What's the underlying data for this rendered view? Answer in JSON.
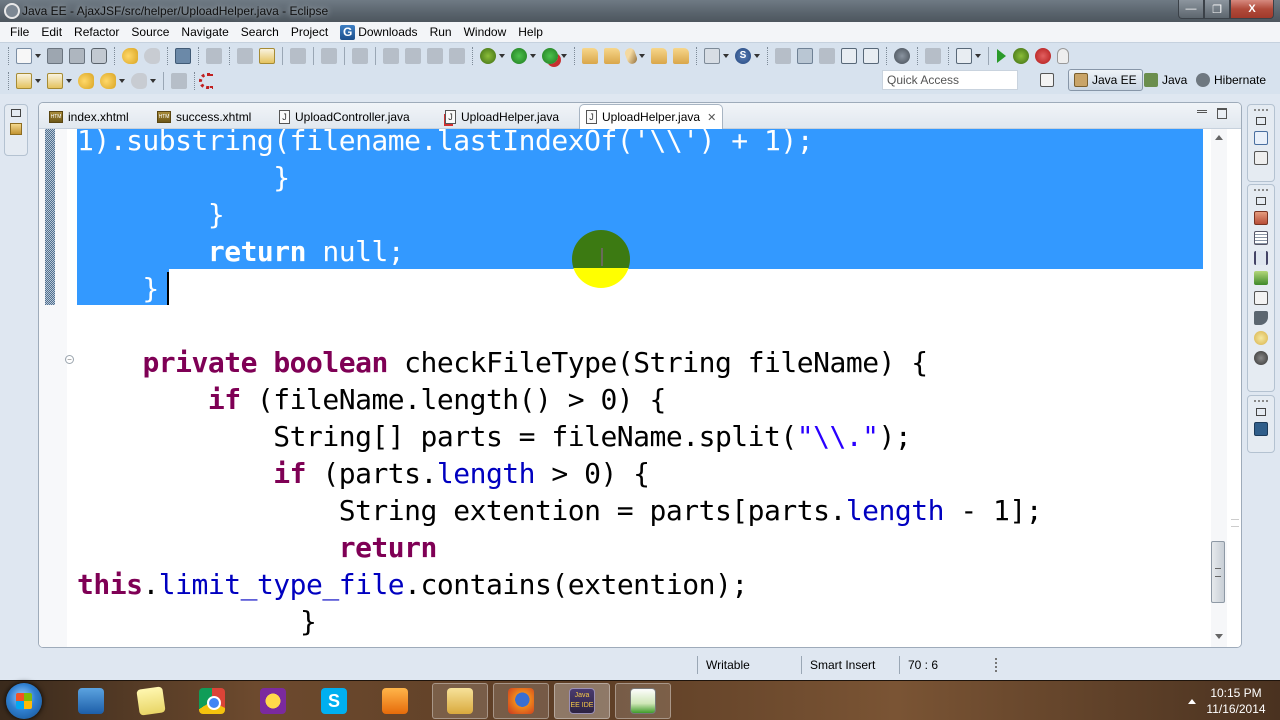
{
  "window": {
    "title": "Java EE - AjaxJSF/src/helper/UploadHelper.java - Eclipse",
    "buttons": {
      "minimize": "—",
      "maximize": "❐",
      "close": "X"
    }
  },
  "menu": {
    "items": [
      "File",
      "Edit",
      "Refactor",
      "Source",
      "Navigate",
      "Search",
      "Project",
      "Downloads",
      "Run",
      "Window",
      "Help"
    ],
    "downloads_icon_letter": "G"
  },
  "toolbar": {
    "quick_access_placeholder": "Quick Access",
    "perspectives": [
      {
        "label": "Java EE",
        "active": true
      },
      {
        "label": "Java",
        "active": false
      },
      {
        "label": "Hibernate",
        "active": false
      }
    ]
  },
  "editor": {
    "tabs": [
      {
        "label": "index.xhtml",
        "type": "xhtml",
        "active": false
      },
      {
        "label": "success.xhtml",
        "type": "xhtml",
        "active": false
      },
      {
        "label": "UploadController.java",
        "type": "java",
        "active": false
      },
      {
        "label": "UploadHelper.java",
        "type": "java-error",
        "active": false
      },
      {
        "label": "UploadHelper.java",
        "type": "java",
        "active": true
      }
    ],
    "tab_close_glyph": "✕",
    "fold_glyph": "−",
    "code": {
      "line1": "1).substring(filename.lastIndexOf('\\\\') + 1);",
      "line2": "            }",
      "line3": "        }",
      "line4_kw": "return",
      "line4_rest": " null;",
      "line5": "    }",
      "line7_kw1": "private",
      "line7_kw2": "boolean",
      "line7_rest": " checkFileType(String fileName) {",
      "line8_kw": "if",
      "line8_rest": " (fileName.length() > 0) {",
      "line9_a": "String[] parts = fileName.split(",
      "line9_str": "\"\\\\.\"",
      "line9_b": ");",
      "line10_kw": "if",
      "line10_a": " (parts.",
      "line10_fld": "length",
      "line10_b": " > 0) {",
      "line11_a": "String extention = parts[parts.",
      "line11_fld": "length",
      "line11_b": " - 1];",
      "line12_kw": "return",
      "line13_kw": "this",
      "line13_a": ".",
      "line13_fld": "limit_type_file",
      "line13_b": ".contains(extention);",
      "line14": "}"
    }
  },
  "statusbar": {
    "writable": "Writable",
    "insert_mode": "Smart Insert",
    "cursor_position": "70 : 6"
  },
  "taskbar": {
    "apps": [
      "Windows Media Player",
      "Sticky Notes",
      "Google Chrome",
      "Yahoo Messenger",
      "Skype",
      "Outlook",
      "Windows Explorer",
      "Firefox",
      "Java EE IDE",
      "Notepad++"
    ],
    "skype_letter": "S",
    "javaee_label": "Java EE IDE",
    "clock_time": "10:15 PM",
    "clock_date": "11/16/2014"
  },
  "colors": {
    "selection": "#3399ff",
    "keyword": "#7f0055",
    "field": "#0000c0",
    "string": "#2a00ff"
  }
}
